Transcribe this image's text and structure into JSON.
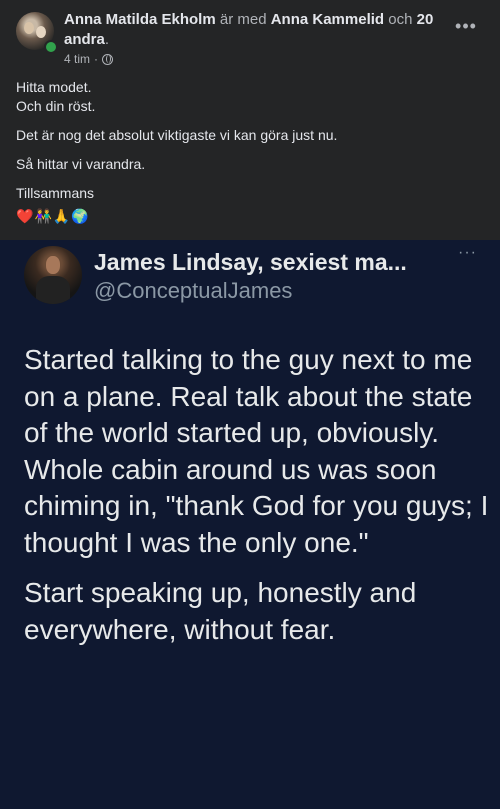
{
  "post": {
    "author_name": "Anna Matilda Ekholm",
    "with_text": "är med",
    "tagged_name": "Anna Kammelid",
    "and_text": "och",
    "others_text": "20 andra",
    "period": ".",
    "time": "4 tim",
    "separator": "·",
    "privacy_icon": "globe-icon",
    "more_label": "•••",
    "text_lines": [
      "Hitta modet.",
      "Och din röst.",
      "Det är nog det absolut viktigaste vi kan göra just nu.",
      "Så hittar vi varandra.",
      "Tillsammans"
    ],
    "emojis": [
      "❤️",
      "👫",
      "🙏",
      "🌍"
    ]
  },
  "tweet": {
    "name": "James Lindsay, sexiest ma...",
    "handle": "@ConceptualJames",
    "more_label": "···",
    "paragraph_1": "Started talking to the guy next to me on a plane. Real talk about the state of the world started up, obviously. Whole cabin around us was soon chiming in, \"thank God for you guys; I thought I was the only one.\"",
    "paragraph_2": "Start speaking up, honestly and everywhere, without fear."
  },
  "colors": {
    "background": "#242526",
    "tweet_background": "#0f1830",
    "online": "#31a24c"
  }
}
